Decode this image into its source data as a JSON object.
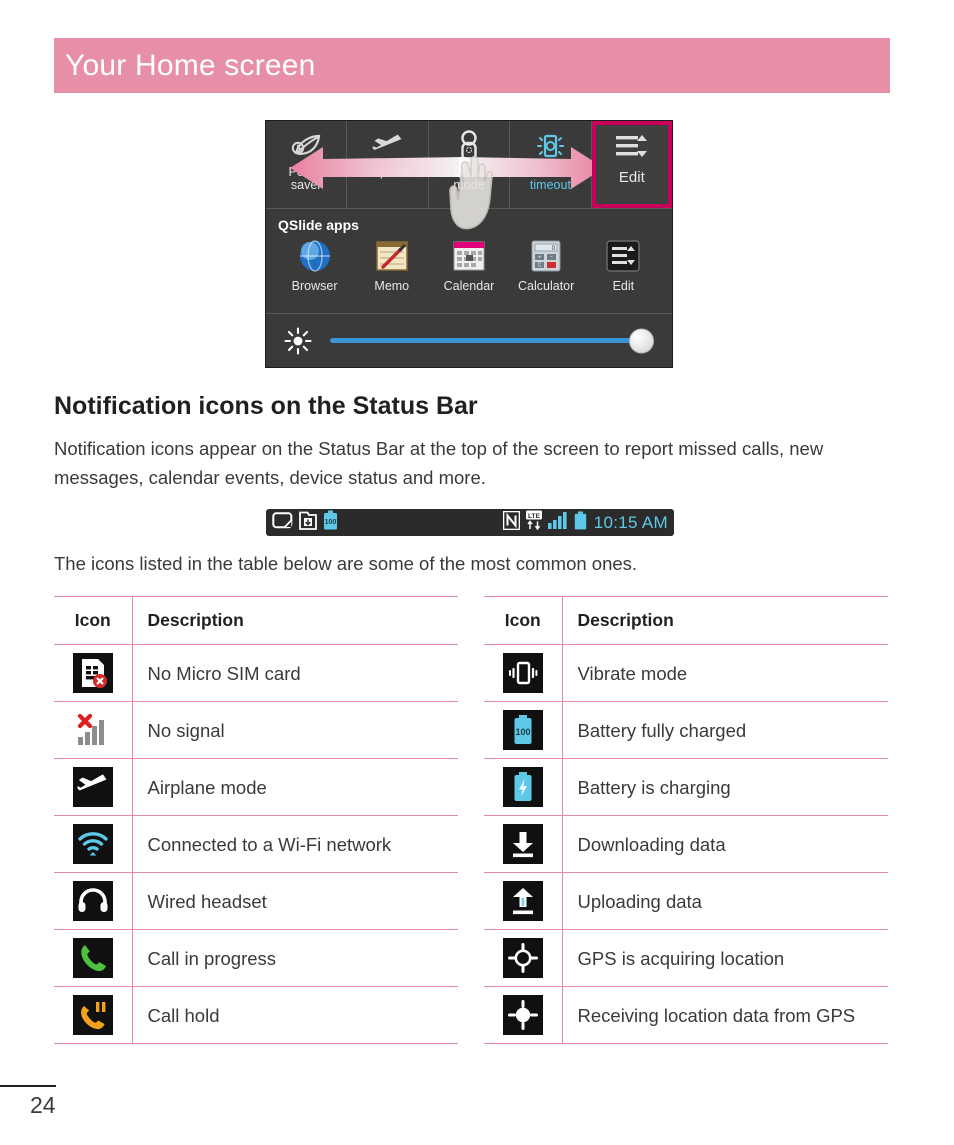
{
  "header": {
    "title": "Your Home screen"
  },
  "phone_figure": {
    "quick_settings": [
      {
        "label": "Power\nsaver",
        "icon": "power-saver-icon",
        "state": "off",
        "highlighted": false
      },
      {
        "label": "Airplane",
        "icon": "airplane-icon",
        "state": "off",
        "highlighted": false
      },
      {
        "label": "Quiet\nmode",
        "icon": "quiet-mode-icon",
        "state": "off",
        "highlighted": false
      },
      {
        "label": "Screen\ntimeout",
        "icon": "screen-timeout-icon",
        "state": "on",
        "highlighted": false
      },
      {
        "label": "Edit",
        "icon": "edit-list-icon",
        "state": "off",
        "highlighted": true
      }
    ],
    "qslide": {
      "title": "QSlide apps",
      "apps": [
        {
          "label": "Browser",
          "icon": "browser-globe-icon"
        },
        {
          "label": "Memo",
          "icon": "memo-notepad-icon"
        },
        {
          "label": "Calendar",
          "icon": "calendar-icon"
        },
        {
          "label": "Calculator",
          "icon": "calculator-icon"
        },
        {
          "label": "Edit",
          "icon": "edit-list-icon"
        }
      ]
    },
    "brightness": {
      "icon": "brightness-sun-icon",
      "value_percent": 94
    },
    "gesture": {
      "left_arrow": "swipe-left-arrow",
      "right_arrow": "swipe-right-arrow",
      "hand": "hand-pointer-illustration"
    },
    "colors": {
      "highlight_border": "#c8005a",
      "arrow_pink": "#e8809f",
      "panel_bg": "#3a3a3a",
      "accent_cyan": "#5ec8e8"
    }
  },
  "body": {
    "section_heading": "Notification icons on the Status Bar",
    "paragraph_1": "Notification icons appear on the Status Bar at the top of the screen to report missed calls, new messages, calendar events, device status and more.",
    "paragraph_2": "The icons listed in the table below are some of the most common ones."
  },
  "status_bar": {
    "left_icons": [
      {
        "name": "qslide-icon"
      },
      {
        "name": "download-to-device-icon"
      },
      {
        "name": "battery-100-icon",
        "label": "100"
      }
    ],
    "right_icons": [
      {
        "name": "nfc-icon"
      },
      {
        "name": "lte-data-icon",
        "label": "LTE"
      },
      {
        "name": "signal-bars-icon"
      },
      {
        "name": "battery-icon"
      }
    ],
    "time": "10:15 AM"
  },
  "tables": {
    "headers": {
      "icon": "Icon",
      "description": "Description"
    },
    "left_rows": [
      {
        "icon": "no-micro-sim-card-icon",
        "description": "No Micro SIM card"
      },
      {
        "icon": "no-signal-icon",
        "description": "No signal"
      },
      {
        "icon": "airplane-mode-icon",
        "description": "Airplane mode"
      },
      {
        "icon": "wifi-connected-icon",
        "description": "Connected to a Wi-Fi network"
      },
      {
        "icon": "wired-headset-icon",
        "description": "Wired headset"
      },
      {
        "icon": "call-in-progress-icon",
        "description": "Call in progress"
      },
      {
        "icon": "call-hold-icon",
        "description": "Call hold"
      }
    ],
    "right_rows": [
      {
        "icon": "vibrate-mode-icon",
        "description": "Vibrate mode"
      },
      {
        "icon": "battery-full-icon",
        "description": "Battery fully charged"
      },
      {
        "icon": "battery-charging-icon",
        "description": "Battery is charging"
      },
      {
        "icon": "downloading-data-icon",
        "description": "Downloading data"
      },
      {
        "icon": "uploading-data-icon",
        "description": "Uploading data"
      },
      {
        "icon": "gps-acquiring-icon",
        "description": "GPS is acquiring location"
      },
      {
        "icon": "gps-receiving-icon",
        "description": "Receiving location data from GPS"
      }
    ]
  },
  "footer": {
    "page_number": "24"
  }
}
